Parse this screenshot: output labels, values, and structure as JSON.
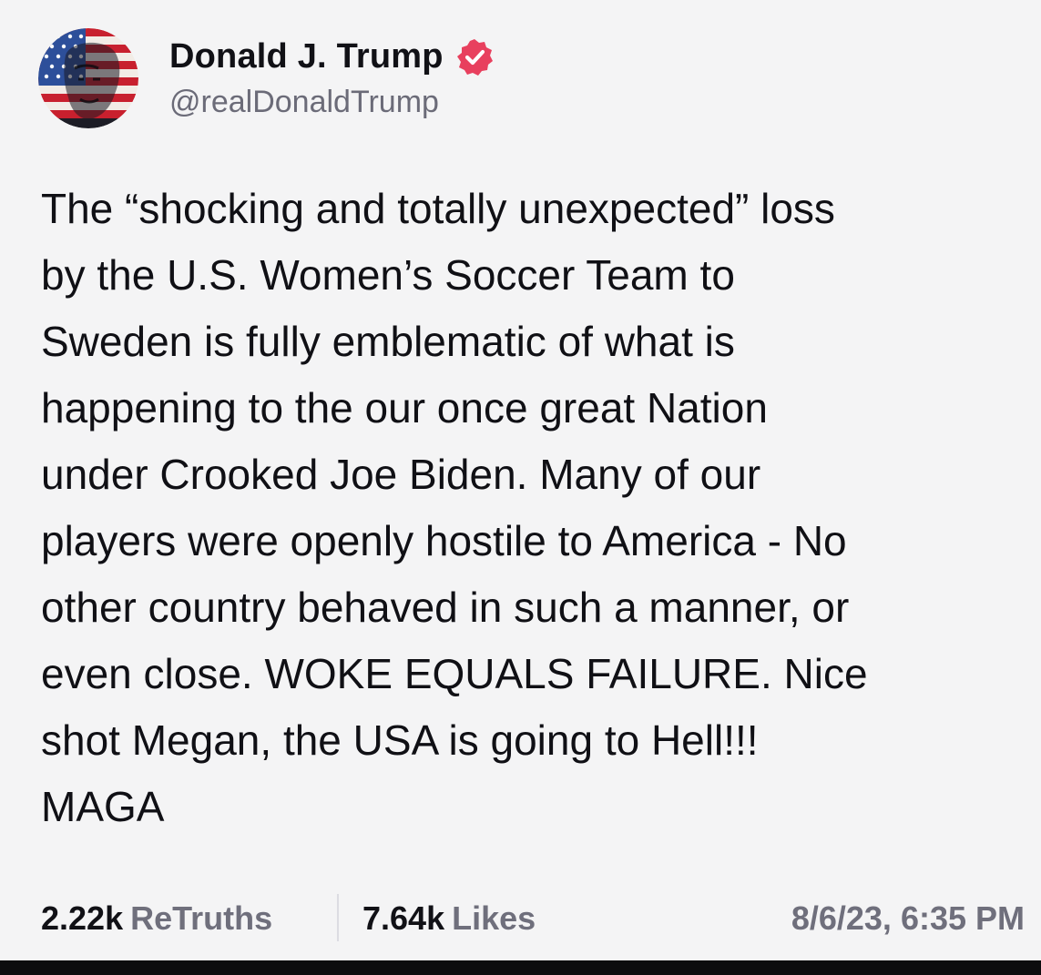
{
  "author": {
    "display_name": "Donald J. Trump",
    "handle": "@realDonaldTrump",
    "verified": true,
    "verified_badge_color": "#e8405e",
    "avatar_icon": "flag-portrait-avatar"
  },
  "post": {
    "lines": [
      "The “shocking and totally unexpected” loss",
      "by the U.S. Women’s Soccer Team to",
      "Sweden is fully emblematic of what is",
      "happening to the our once great Nation",
      "under Crooked Joe Biden. Many of our",
      "players were openly hostile to America - No",
      "other country behaved in such a manner, or",
      "even close. WOKE EQUALS FAILURE. Nice",
      "shot Megan, the USA is going to Hell!!!",
      "MAGA"
    ]
  },
  "stats": {
    "retruths_count": "2.22k",
    "retruths_label": "ReTruths",
    "likes_count": "7.64k",
    "likes_label": "Likes",
    "timestamp": "8/6/23, 6:35 PM"
  },
  "colors": {
    "background": "#f4f4f5",
    "text": "#101015",
    "muted": "#6f6f7c"
  }
}
